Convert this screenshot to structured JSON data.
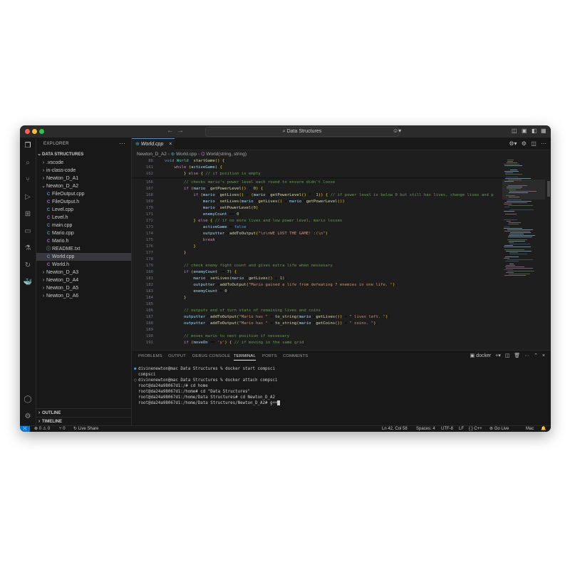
{
  "titlebar": {
    "search_text": "Data Structures"
  },
  "sidebar": {
    "title": "EXPLORER",
    "root": "DATA STRUCTURES",
    "items": [
      {
        "label": ".vscode",
        "kind": "folder",
        "open": false,
        "depth": 1
      },
      {
        "label": "in-class-code",
        "kind": "folder",
        "open": false,
        "depth": 1
      },
      {
        "label": "Newton_D_A1",
        "kind": "folder",
        "open": false,
        "depth": 1
      },
      {
        "label": "Newton_D_A2",
        "kind": "folder",
        "open": true,
        "depth": 1
      },
      {
        "label": "FileOutput.cpp",
        "kind": "cpp",
        "depth": 2
      },
      {
        "label": "FileOutput.h",
        "kind": "h",
        "depth": 2
      },
      {
        "label": "Level.cpp",
        "kind": "cpp",
        "depth": 2
      },
      {
        "label": "Level.h",
        "kind": "h",
        "depth": 2
      },
      {
        "label": "main.cpp",
        "kind": "cpp",
        "depth": 2
      },
      {
        "label": "Mario.cpp",
        "kind": "cpp",
        "depth": 2
      },
      {
        "label": "Mario.h",
        "kind": "h",
        "depth": 2
      },
      {
        "label": "README.txt",
        "kind": "txt",
        "depth": 2
      },
      {
        "label": "World.cpp",
        "kind": "cpp",
        "depth": 2,
        "selected": true
      },
      {
        "label": "World.h",
        "kind": "h",
        "depth": 2
      },
      {
        "label": "Newton_D_A3",
        "kind": "folder",
        "open": false,
        "depth": 1
      },
      {
        "label": "Newton_D_A4",
        "kind": "folder",
        "open": false,
        "depth": 1
      },
      {
        "label": "Newton_D_A5",
        "kind": "folder",
        "open": false,
        "depth": 1
      },
      {
        "label": "Newton_D_A6",
        "kind": "folder",
        "open": false,
        "depth": 1
      }
    ],
    "outline": "OUTLINE",
    "timeline": "TIMELINE"
  },
  "editor": {
    "tab": "World.cpp",
    "breadcrumb": [
      "Newton_D_A2",
      "World.cpp",
      "World(string, string)"
    ],
    "sticky": [
      {
        "n": "88",
        "code": "void World::startGame() {"
      },
      {
        "n": "161",
        "code": "    while (activeGame) {"
      },
      {
        "n": "162",
        "code": "        } else { // if position is empty"
      }
    ],
    "lines": [
      {
        "n": "166",
        "code": "        // checks mario's power level each round to ensure didn't loose"
      },
      {
        "n": "167",
        "code": "        if (mario->getPowerLevel() < 0) {"
      },
      {
        "n": "168",
        "code": "            if (mario->getLives() > (mario->getPowerLevel() * -1)) { // if power level is below 0 but still has lives, change lives and p"
      },
      {
        "n": "169",
        "code": "                mario->setLives(mario->getLives() + mario->getPowerLevel());"
      },
      {
        "n": "170",
        "code": "                mario->setPowerLevel(0);"
      },
      {
        "n": "171",
        "code": "                enemyCount += 0;"
      },
      {
        "n": "172",
        "code": "            } else { // if no more lives and low power level, mario losses"
      },
      {
        "n": "173",
        "code": "                activeGame = false;"
      },
      {
        "n": "174",
        "code": "                outputter->addToOutput(\"\\n\\nWE LOST THE GAME! :(\\n\");"
      },
      {
        "n": "175",
        "code": "                break;"
      },
      {
        "n": "176",
        "code": "            }"
      },
      {
        "n": "177",
        "code": "        }"
      },
      {
        "n": "178",
        "code": ""
      },
      {
        "n": "179",
        "code": "        // check enemy fight count and gives extra life when nessesary"
      },
      {
        "n": "180",
        "code": "        if (enemyCount >= 7) {"
      },
      {
        "n": "181",
        "code": "            mario->setLives(mario->getLives() + 1);"
      },
      {
        "n": "182",
        "code": "            outputter->addToOutput(\"Mario gained a life from defeating 7 enemies in one life. \");"
      },
      {
        "n": "183",
        "code": "            enemyCount = 0;"
      },
      {
        "n": "184",
        "code": "        }"
      },
      {
        "n": "185",
        "code": ""
      },
      {
        "n": "186",
        "code": "        // outputs end of turn stats of remaining lives and coins"
      },
      {
        "n": "187",
        "code": "        outputter->addToOutput(\"Mario has \" + to_string(mario->getLives()) + \" lives left. \");"
      },
      {
        "n": "188",
        "code": "        outputter->addToOutput(\"Mario has \" + to_string(mario->getCoins()) + \" coins. \");"
      },
      {
        "n": "189",
        "code": ""
      },
      {
        "n": "190",
        "code": "        // moves mario to next position if nessesary"
      },
      {
        "n": "191",
        "code": "        if (moveOn == 'y') { // if moving in the same grid"
      }
    ]
  },
  "panel": {
    "tabs": [
      "PROBLEMS",
      "OUTPUT",
      "DEBUG CONSOLE",
      "TERMINAL",
      "PORTS",
      "COMMENTS"
    ],
    "active_tab": "TERMINAL",
    "shell": "docker",
    "terminal": [
      "divinenewton@mac Data Structures % docker start compsci",
      "compsci",
      "divinenewton@mac Data Structures % docker attach compsci",
      "root@da24a98067d1:/# cd home",
      "root@da24a98067d1:/home# cd \"Data Structures\"",
      "root@da24a98067d1:/home/Data Structures# cd Newton_D_A2",
      "root@da24a98067d1:/home/Data Structures/Newton_D_A2# g++"
    ]
  },
  "status": {
    "problems": "⊗ 0 ⚠ 0",
    "ports": "⑂ 0",
    "live_share": "Live Share",
    "position": "Ln 42, Col 58",
    "spaces": "Spaces: 4",
    "encoding": "UTF-8",
    "eol": "LF",
    "language": "{ } C++",
    "go_live": "Go Live",
    "platform": "Mac"
  },
  "colors": {
    "accent": "#0078d4",
    "background": "#1e1e1e",
    "sidebar": "#181818"
  }
}
